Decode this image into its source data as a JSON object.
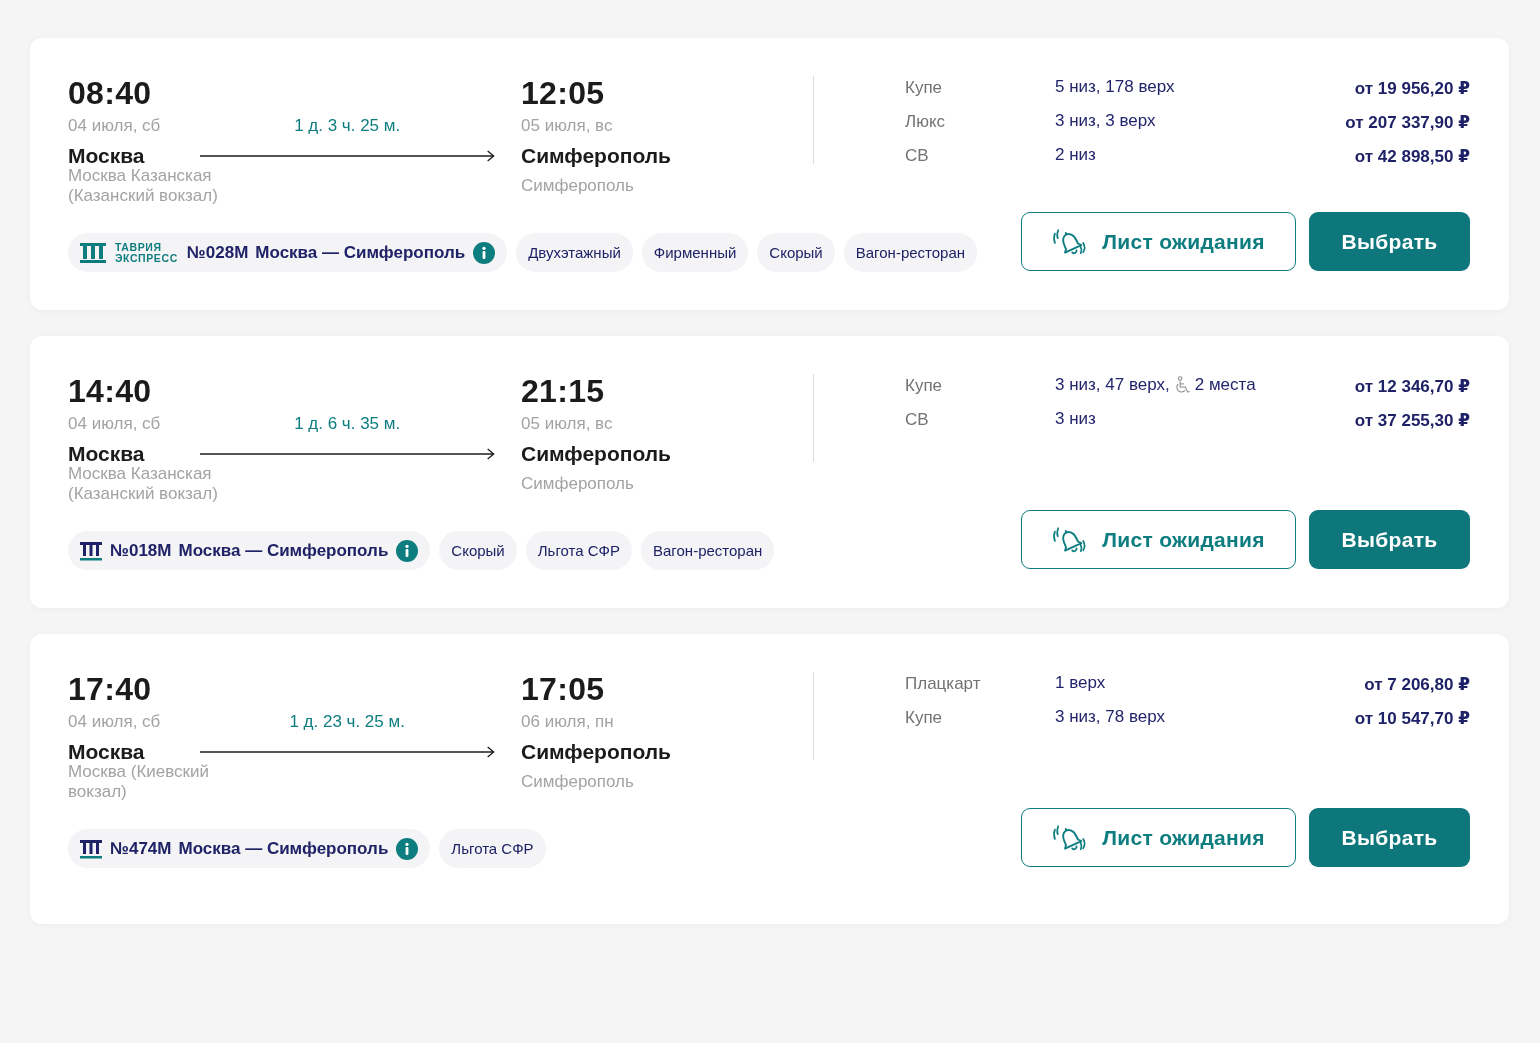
{
  "trips": [
    {
      "departure": {
        "time": "08:40",
        "date": "04 июля, сб",
        "city": "Москва",
        "station": "Москва Казанская (Казанский вокзал)"
      },
      "duration": "1 д. 3 ч. 25 м.",
      "arrival": {
        "time": "12:05",
        "date": "05 июля, вс",
        "city": "Симферополь",
        "station": "Симферополь"
      },
      "classes": [
        {
          "name": "Купе",
          "seats": "5 низ, 178 верх",
          "price": "от 19 956,20 ₽"
        },
        {
          "name": "Люкс",
          "seats": "3 низ, 3 верх",
          "price": "от 207 337,90 ₽"
        },
        {
          "name": "СВ",
          "seats": "2 низ",
          "price": "от 42 898,50 ₽"
        }
      ],
      "train": {
        "logo": {
          "kind": "brand",
          "lines": [
            "ТАВРИЯ",
            "ЭКСПРЕСС"
          ]
        },
        "number": "№028М",
        "route": "Москва — Симферополь"
      },
      "tags": [
        "Двухэтажный",
        "Фирменный",
        "Скорый",
        "Вагон-ресторан"
      ],
      "waitlist_button": "Лист ожидания",
      "select_button": "Выбрать"
    },
    {
      "departure": {
        "time": "14:40",
        "date": "04 июля, сб",
        "city": "Москва",
        "station": "Москва Казанская (Казанский вокзал)"
      },
      "duration": "1 д. 6 ч. 35 м.",
      "arrival": {
        "time": "21:15",
        "date": "05 июля, вс",
        "city": "Симферополь",
        "station": "Симферополь"
      },
      "classes": [
        {
          "name": "Купе",
          "seats": "3 низ, 47 верх,",
          "accessible_seats": "2 места",
          "price": "от 12 346,70 ₽"
        },
        {
          "name": "СВ",
          "seats": "3 низ",
          "price": "от 37 255,30 ₽"
        }
      ],
      "train": {
        "logo": {
          "kind": "plain"
        },
        "number": "№018М",
        "route": "Москва — Симферополь"
      },
      "tags": [
        "Скорый",
        "Льгота СФР",
        "Вагон-ресторан"
      ],
      "waitlist_button": "Лист ожидания",
      "select_button": "Выбрать"
    },
    {
      "departure": {
        "time": "17:40",
        "date": "04 июля, сб",
        "city": "Москва",
        "station": "Москва (Киевский вокзал)"
      },
      "duration": "1 д. 23 ч. 25 м.",
      "arrival": {
        "time": "17:05",
        "date": "06 июля, пн",
        "city": "Симферополь",
        "station": "Симферополь"
      },
      "classes": [
        {
          "name": "Плацкарт",
          "seats": "1 верх",
          "price": "от 7 206,80 ₽"
        },
        {
          "name": "Купе",
          "seats": "3 низ, 78 верх",
          "price": "от 10 547,70 ₽"
        }
      ],
      "train": {
        "logo": {
          "kind": "plain"
        },
        "number": "№474М",
        "route": "Москва — Симферополь"
      },
      "tags": [
        "Льгота СФР"
      ],
      "waitlist_button": "Лист ожидания",
      "select_button": "Выбрать"
    }
  ]
}
